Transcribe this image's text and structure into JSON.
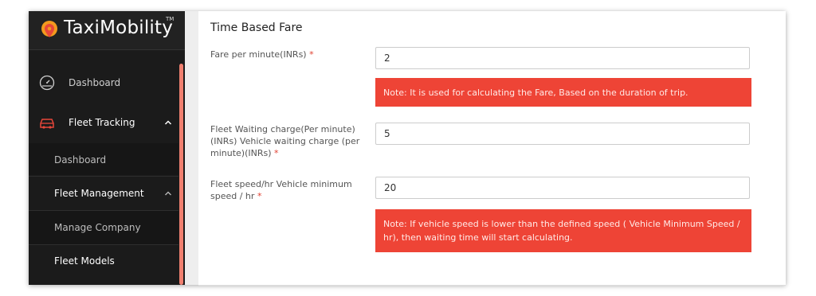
{
  "brand": {
    "name": "TaxiMobility",
    "trademark": "TM"
  },
  "sidebar": {
    "items": [
      {
        "label": "Dashboard",
        "icon": "speedometer-icon"
      },
      {
        "label": "Fleet Tracking",
        "icon": "car-icon"
      }
    ],
    "subitems": [
      {
        "label": "Dashboard"
      },
      {
        "label": "Fleet Management"
      },
      {
        "label": "Manage Company"
      },
      {
        "label": "Fleet Models"
      }
    ]
  },
  "section": {
    "title": "Time Based Fare"
  },
  "fields": [
    {
      "label": "Fare per minute(INRs)",
      "value": "2"
    },
    {
      "label": "Fleet Waiting charge(Per minute)(INRs) Vehicle waiting charge (per minute)(INRs)",
      "value": "5"
    },
    {
      "label": "Fleet speed/hr Vehicle minimum speed / hr",
      "value": "20"
    }
  ],
  "notes": [
    "Note: It is used for calculating the Fare, Based on the duration of trip.",
    "Note: If vehicle speed is lower than the defined speed ( Vehicle Minimum Speed / hr), then waiting time will start calculating."
  ],
  "colors": {
    "accent": "#ee4436",
    "sidebar_bg": "#1b1b1b",
    "active_icon": "#e8473a"
  }
}
